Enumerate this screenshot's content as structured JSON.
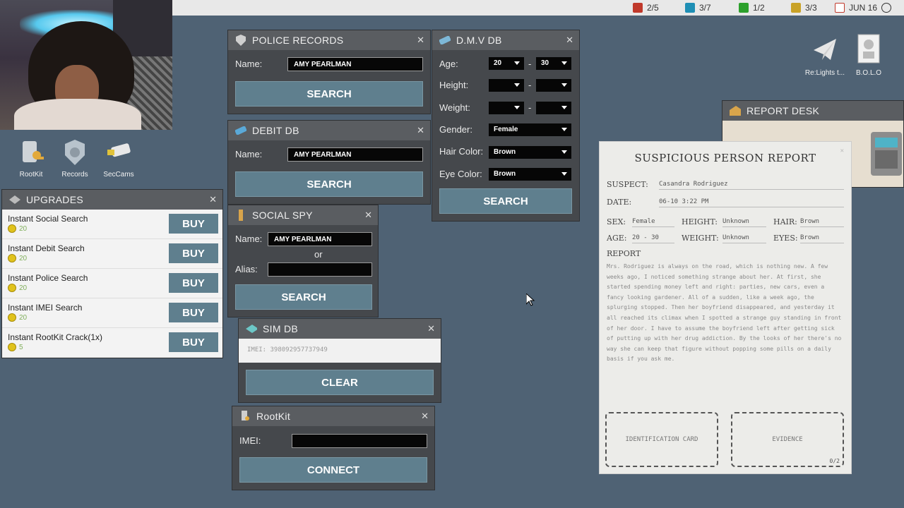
{
  "topbar": {
    "stats": [
      {
        "icon": "case-icon",
        "value": "2/5",
        "color": "#c0392b"
      },
      {
        "icon": "document-icon",
        "value": "3/7",
        "color": "#1f8fb5"
      },
      {
        "icon": "evidence-icon",
        "value": "1/2",
        "color": "#2ca02c"
      },
      {
        "icon": "notepad-icon",
        "value": "3/3",
        "color": "#c9a227"
      },
      {
        "icon": "calendar-icon",
        "value": "JUN 16",
        "color": "#c0392b"
      }
    ]
  },
  "desktop": {
    "icons": [
      {
        "name": "rootkit-icon",
        "label": "RootKit"
      },
      {
        "name": "records-icon",
        "label": "Records"
      },
      {
        "name": "seccams-icon",
        "label": "SecCams"
      }
    ],
    "right_icons": [
      {
        "name": "mail-icon",
        "label": "Re:Lights t..."
      },
      {
        "name": "bolo-icon",
        "label": "B.O.L.O"
      }
    ]
  },
  "police": {
    "title": "POLICE RECORDS",
    "name_label": "Name:",
    "name_value": "AMY PEARLMAN",
    "search": "SEARCH"
  },
  "debit": {
    "title": "DEBIT DB",
    "name_label": "Name:",
    "name_value": "AMY PEARLMAN",
    "search": "SEARCH"
  },
  "social": {
    "title": "SOCIAL SPY",
    "name_label": "Name:",
    "name_value": "AMY PEARLMAN",
    "or": "or",
    "alias_label": "Alias:",
    "alias_value": "",
    "search": "SEARCH"
  },
  "sim": {
    "title": "SIM DB",
    "imei_value": "IMEI: 398092957737949",
    "clear": "CLEAR"
  },
  "rootkit": {
    "title": "RootKit",
    "imei_label": "IMEI:",
    "imei_value": "",
    "connect": "CONNECT"
  },
  "dmv": {
    "title": "D.M.V DB",
    "age_label": "Age:",
    "age_min": "20",
    "age_max": "30",
    "dash": "-",
    "height_label": "Height:",
    "height_min": "",
    "height_max": "",
    "weight_label": "Weight:",
    "weight_min": "",
    "weight_max": "",
    "gender_label": "Gender:",
    "gender": "Female",
    "hair_label": "Hair Color:",
    "hair": "Brown",
    "eye_label": "Eye Color:",
    "eye": "Brown",
    "search": "SEARCH"
  },
  "upgrades": {
    "title": "UPGRADES",
    "items": [
      {
        "name": "Instant Social Search",
        "cost": "20",
        "buy": "BUY"
      },
      {
        "name": "Instant Debit Search",
        "cost": "20",
        "buy": "BUY"
      },
      {
        "name": "Instant Police Search",
        "cost": "20",
        "buy": "BUY"
      },
      {
        "name": "Instant IMEI Search",
        "cost": "20",
        "buy": "BUY"
      },
      {
        "name": "Instant RootKit Crack(1x)",
        "cost": "5",
        "buy": "BUY"
      }
    ]
  },
  "report_desk": {
    "title": "REPORT DESK"
  },
  "report": {
    "title": "SUSPICIOUS PERSON REPORT",
    "suspect_label": "SUSPECT:",
    "suspect": "Casandra Rodriguez",
    "date_label": "DATE:",
    "date": "06-10 3:22 PM",
    "sex_label": "SEX:",
    "sex": "Female",
    "height_label": "HEIGHT:",
    "height": "Unknown",
    "hair_label": "HAIR:",
    "hair": "Brown",
    "age_label": "AGE:",
    "age": "20 - 30",
    "weight_label": "WEIGHT:",
    "weight": "Unknown",
    "eyes_label": "EYES:",
    "eyes": "Brown",
    "report_label": "REPORT",
    "body": "Mrs. Rodriguez is always on the road, which is nothing new. A few weeks ago, I noticed something strange about her. At first, she started spending money left and right: parties, new cars, even a fancy looking gardener. All of a sudden, like a week ago, the splurging stopped. Then her boyfriend disappeared, and yesterday it all reached its climax when I spotted a strange guy standing in front of her door. I have to assume the boyfriend left after getting sick of putting up with her drug addiction. By the looks of her there's no way she can keep that figure without popping some pills on a daily basis if you ask me.",
    "id_card": "IDENTIFICATION CARD",
    "evidence": "EVIDENCE",
    "evidence_count": "0/2"
  }
}
